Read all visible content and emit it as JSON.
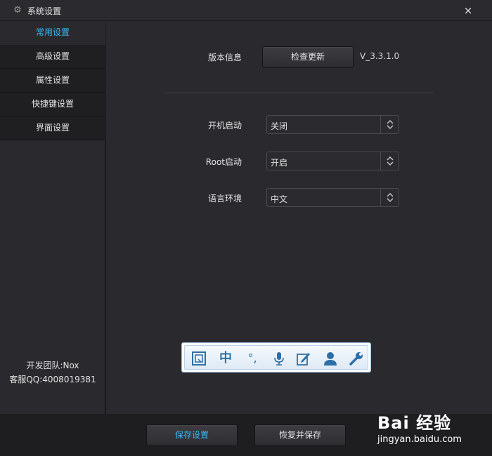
{
  "window": {
    "title": "系统设置",
    "close_label": "×"
  },
  "sidebar": {
    "tabs": [
      {
        "label": "常用设置",
        "active": true
      },
      {
        "label": "高级设置"
      },
      {
        "label": "属性设置"
      },
      {
        "label": "快捷键设置"
      },
      {
        "label": "界面设置"
      }
    ],
    "footer": {
      "team": "开发团队:Nox",
      "support": "客服QQ:4008019381"
    }
  },
  "main": {
    "version": {
      "label": "版本信息",
      "button": "检查更新",
      "value": "V_3.3.1.0"
    },
    "boot": {
      "label": "开机启动",
      "value": "关闭"
    },
    "root": {
      "label": "Root启动",
      "value": "开启"
    },
    "language": {
      "label": "语言环境",
      "value": "中文"
    }
  },
  "ime": {
    "icons": [
      "keyboard-icon",
      "chinese-mode-icon",
      "punctuation-icon",
      "microphone-icon",
      "handwriting-icon",
      "user-icon",
      "wrench-icon"
    ],
    "chinese_glyph": "中",
    "punct_glyph": "°,"
  },
  "footer": {
    "save": "保存设置",
    "restore": "恢复并保存"
  },
  "watermark": {
    "logo": "Bai 经验",
    "url": "jingyan.baidu.com"
  },
  "colors": {
    "accent": "#38b8f0",
    "background": "#2a2a2e",
    "ime_blue": "#2d6fa8"
  }
}
